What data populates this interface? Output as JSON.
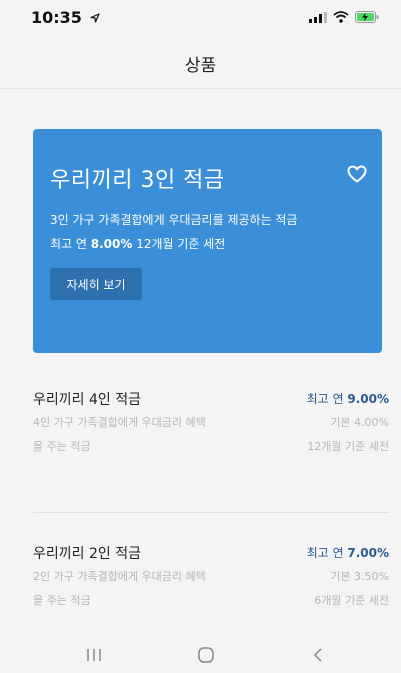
{
  "status_bar": {
    "time": "10:35",
    "location_icon": "location-arrow-icon",
    "signal_icon": "signal-icon",
    "wifi_icon": "wifi-icon",
    "battery_icon": "battery-charging-icon"
  },
  "header": {
    "title": "상품"
  },
  "featured": {
    "title": "우리끼리 3인 적금",
    "heart_icon": "heart-icon",
    "desc_line1": "3인 가구 가족결합에게 우대금리를 제공하는 적금",
    "desc_line2_prefix": "최고 연 ",
    "desc_line2_rate": "8.00%",
    "desc_line2_suffix": " 12개월 기준 세전",
    "button_label": "자세히 보기",
    "color": "#3b8fd8"
  },
  "products": [
    {
      "name": "우리끼리 4인 적금",
      "max_rate_prefix": "최고 연 ",
      "max_rate": "9.00%",
      "desc_line1": "4인 가구 가족결합에게 우대금리 혜택",
      "desc_line2": "을 주는 적금",
      "base_rate": "기본 4.00%",
      "period": "12개월 기준 세전"
    },
    {
      "name": "우리끼리 2인 적금",
      "max_rate_prefix": "최고 연 ",
      "max_rate": "7.00%",
      "desc_line1": "2인 가구 가족결합에게 우대금리 혜택",
      "desc_line2": "을 주는 적금",
      "base_rate": "기본 3.50%",
      "period": "6개월 기준 세전"
    }
  ],
  "nav": {
    "recent_icon": "recent-apps-icon",
    "home_icon": "home-icon",
    "back_icon": "back-icon"
  }
}
